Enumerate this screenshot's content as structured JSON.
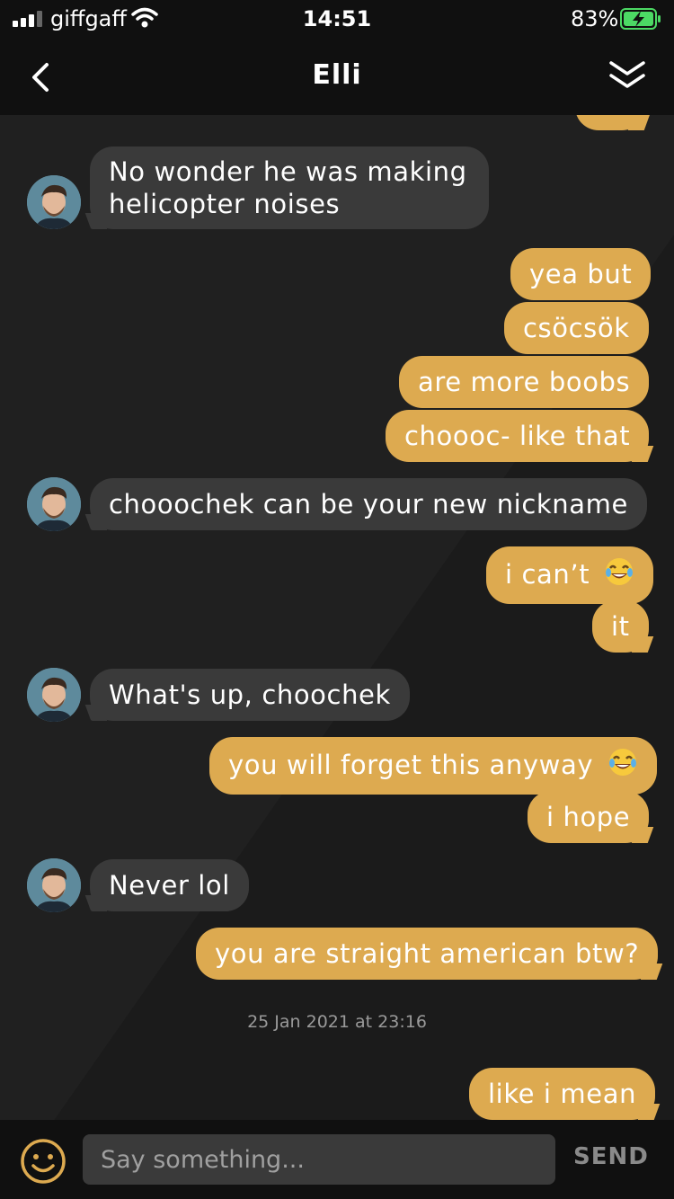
{
  "status": {
    "carrier": "giffgaff",
    "time": "14:51",
    "battery": "83%"
  },
  "header": {
    "title": "Elli"
  },
  "messages": [
    {
      "text": "No wonder he was making",
      "text2": "helicopter noises"
    },
    {
      "text": "yea but"
    },
    {
      "text": "csöcsök"
    },
    {
      "text": "are more boobs"
    },
    {
      "text": "choooc- like that"
    },
    {
      "text": "chooochek can be your new nickname"
    },
    {
      "text": "i can’t"
    },
    {
      "text": "it"
    },
    {
      "text": "What's up, choochek"
    },
    {
      "text": "you will forget this anyway"
    },
    {
      "text": "i hope"
    },
    {
      "text": "Never lol"
    },
    {
      "text": "you are straight american btw?"
    },
    {
      "text": "like i mean"
    }
  ],
  "timestamp": "25 Jan 2021 at 23:16",
  "composer": {
    "placeholder": "Say something...",
    "send_label": "SEND"
  },
  "colors": {
    "outgoing_bubble": "#ddaa50",
    "incoming_bubble": "#3a3a3a",
    "bar_background": "#101010"
  }
}
